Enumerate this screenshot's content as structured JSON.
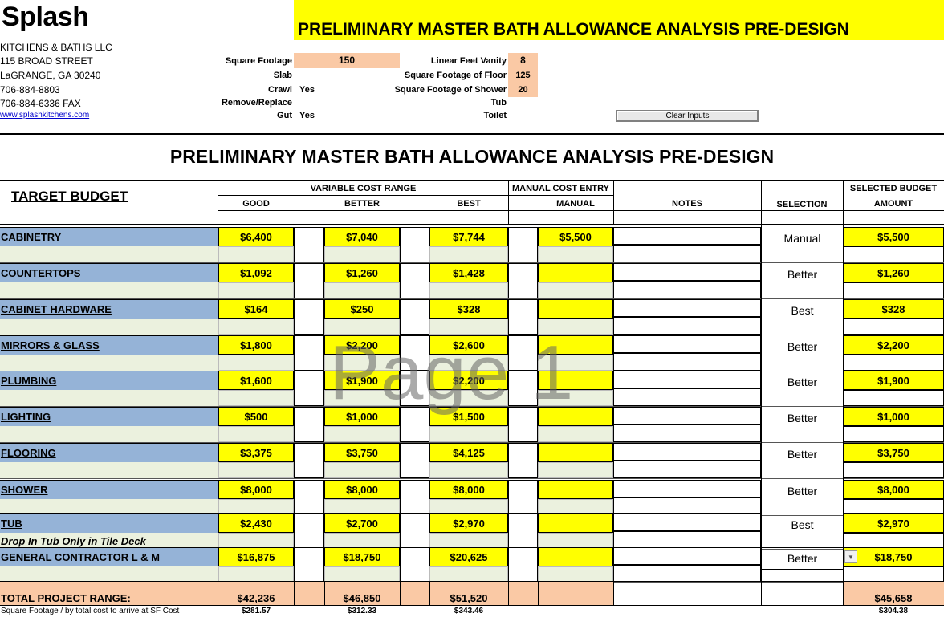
{
  "company": {
    "logo": "Splash",
    "name": "KITCHENS & BATHS LLC",
    "street": "115 BROAD STREET",
    "city": "LaGRANGE, GA 30240",
    "phone": "706-884-8803",
    "fax": "706-884-6336   FAX",
    "website": "www.splashkitchens.com"
  },
  "banner_title": "PRELIMINARY MASTER BATH ALLOWANCE ANALYSIS PRE-DESIGN",
  "inputs": {
    "square_footage_label": "Square Footage",
    "square_footage_value": "150",
    "slab_label": "Slab",
    "crawl_label": "Crawl",
    "crawl_value": "Yes",
    "remove_label": "Remove/Replace",
    "gut_label": "Gut",
    "gut_value": "Yes",
    "vanity_label": "Linear Feet Vanity",
    "vanity_value": "8",
    "floor_label": "Square Footage of Floor",
    "floor_value": "125",
    "shower_label": "Square Footage of Shower",
    "shower_value": "20",
    "tub_label": "Tub",
    "toilet_label": "Toilet"
  },
  "clear_button": "Clear Inputs",
  "table_title": "PRELIMINARY MASTER BATH ALLOWANCE ANALYSIS PRE-DESIGN",
  "headers": {
    "target_budget": "TARGET BUDGET",
    "variable_range": "VARIABLE COST RANGE",
    "good": "GOOD",
    "better": "BETTER",
    "best": "BEST",
    "manual_entry": "MANUAL COST ENTRY",
    "manual": "MANUAL",
    "notes": "NOTES",
    "selection": "SELECTION",
    "selected_budget": "SELECTED BUDGET",
    "amount": "AMOUNT"
  },
  "rows": [
    {
      "name": "CABINETRY",
      "good": "$6,400",
      "better": "$7,040",
      "best": "$7,744",
      "manual": "$5,500",
      "selection": "Manual",
      "amount": "$5,500"
    },
    {
      "name": "COUNTERTOPS",
      "good": "$1,092",
      "better": "$1,260",
      "best": "$1,428",
      "manual": "",
      "selection": "Better",
      "amount": "$1,260"
    },
    {
      "name": "CABINET HARDWARE",
      "good": "$164",
      "better": "$250",
      "best": "$328",
      "manual": "",
      "selection": "Best",
      "amount": "$328"
    },
    {
      "name": "MIRRORS & GLASS",
      "good": "$1,800",
      "better": "$2,200",
      "best": "$2,600",
      "manual": "",
      "selection": "Better",
      "amount": "$2,200"
    },
    {
      "name": "PLUMBING",
      "good": "$1,600",
      "better": "$1,900",
      "best": "$2,200",
      "manual": "",
      "selection": "Better",
      "amount": "$1,900"
    },
    {
      "name": "LIGHTING",
      "good": "$500",
      "better": "$1,000",
      "best": "$1,500",
      "manual": "",
      "selection": "Better",
      "amount": "$1,000"
    },
    {
      "name": "FLOORING",
      "good": "$3,375",
      "better": "$3,750",
      "best": "$4,125",
      "manual": "",
      "selection": "Better",
      "amount": "$3,750"
    },
    {
      "name": "SHOWER",
      "good": "$8,000",
      "better": "$8,000",
      "best": "$8,000",
      "manual": "",
      "selection": "Better",
      "amount": "$8,000"
    },
    {
      "name": "TUB",
      "sub": "Drop In Tub Only in Tile Deck",
      "good": "$2,430",
      "better": "$2,700",
      "best": "$2,970",
      "manual": "",
      "selection": "Best",
      "amount": "$2,970"
    },
    {
      "name": "GENERAL CONTRACTOR L & M",
      "good": "$16,875",
      "better": "$18,750",
      "best": "$20,625",
      "manual": "",
      "selection": "Better",
      "amount": "$18,750"
    }
  ],
  "totals": {
    "label": "TOTAL PROJECT RANGE:",
    "good": "$42,236",
    "better": "$46,850",
    "best": "$51,520",
    "amount": "$45,658"
  },
  "per_sf": {
    "label": "Square Footage / by total cost to arrive at SF Cost",
    "good": "$281.57",
    "better": "$312.33",
    "best": "$343.46",
    "amount": "$304.38"
  },
  "watermark": "Page 1",
  "colors": {
    "yellow": "#ffff00",
    "category_blue": "#95b3d7",
    "input_tan": "#fac9a5",
    "sub_row_green": "#ebf1de"
  }
}
